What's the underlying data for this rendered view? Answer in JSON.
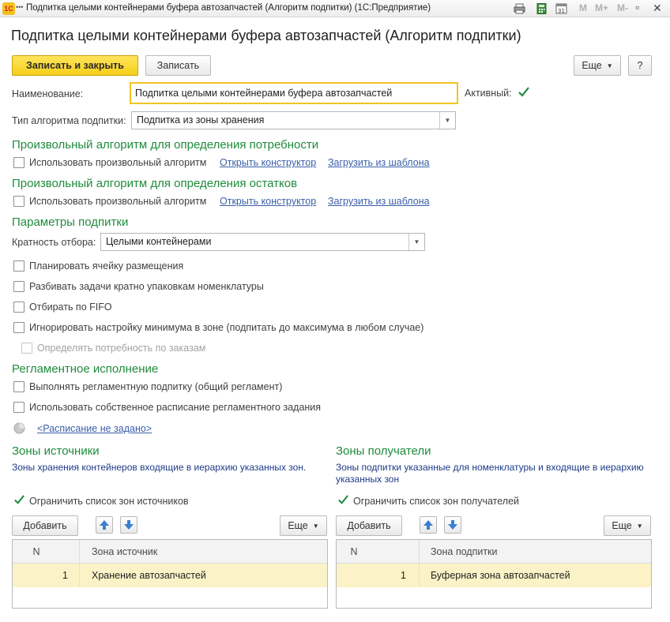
{
  "window": {
    "title": "Подпитка целыми контейнерами буфера автозапчастей (Алгоритм подпитки)  (1С:Предприятие)",
    "app_icon_text": "1С",
    "toolbar_icons": [
      "print-icon",
      "calculator-icon",
      "calendar-icon"
    ],
    "memory_buttons": [
      "M",
      "M+",
      "M-"
    ],
    "controls": [
      "restore-icon",
      "close-icon"
    ]
  },
  "page": {
    "title": "Подпитка целыми контейнерами буфера автозапчастей (Алгоритм подпитки)"
  },
  "command_bar": {
    "save_close": "Записать и закрыть",
    "save": "Записать",
    "more": "Еще",
    "help": "?"
  },
  "form": {
    "name_label": "Наименование:",
    "name_value": "Подпитка целыми контейнерами буфера автозапчастей",
    "active_label": "Активный:",
    "active_checked": true,
    "algo_type_label": "Тип алгоритма подпитки:",
    "algo_type_value": "Подпитка из зоны хранения"
  },
  "demand_section": {
    "title": "Произвольный алгоритм для определения потребности",
    "checkbox_label": "Использовать произвольный алгоритм",
    "link_constructor": "Открыть конструктор",
    "link_template": "Загрузить из шаблона"
  },
  "stock_section": {
    "title": "Произвольный алгоритм для определения остатков",
    "checkbox_label": "Использовать произвольный алгоритм",
    "link_constructor": "Открыть конструктор",
    "link_template": "Загрузить из шаблона"
  },
  "params_section": {
    "title": "Параметры подпитки",
    "multiplicity_label": "Кратность отбора:",
    "multiplicity_value": "Целыми контейнерами",
    "options": [
      {
        "label": "Планировать ячейку размещения",
        "checked": false,
        "disabled": false
      },
      {
        "label": "Разбивать задачи кратно упаковкам номенклатуры",
        "checked": false,
        "disabled": false
      },
      {
        "label": "Отбирать по FIFO",
        "checked": false,
        "disabled": false
      },
      {
        "label": "Игнорировать настройку минимума в зоне (подпитать до максимума в любом случае)",
        "checked": false,
        "disabled": false
      },
      {
        "label": "Определять потребность по заказам",
        "checked": false,
        "disabled": true
      }
    ]
  },
  "schedule_section": {
    "title": "Регламентное исполнение",
    "option_regular": "Выполнять регламентную подпитку (общий регламент)",
    "option_own_schedule": "Использовать собственное расписание регламентного задания",
    "schedule_link": "<Расписание не задано>"
  },
  "sources": {
    "title": "Зоны источники",
    "note": "Зоны хранения контейнеров входящие в иерархию указанных зон.",
    "limit_label": "Ограничить список зон источников",
    "limit_checked": true,
    "add_button": "Добавить",
    "more_button": "Еще",
    "columns": [
      "N",
      "Зона источник"
    ],
    "rows": [
      {
        "n": "1",
        "zone": "Хранение автозапчастей"
      }
    ]
  },
  "receivers": {
    "title": "Зоны получатели",
    "note": "Зоны подпитки указанные для номенклатуры и входящие в иерархию указанных зон",
    "limit_label": "Ограничить список зон получателей",
    "limit_checked": true,
    "add_button": "Добавить",
    "more_button": "Еще",
    "columns": [
      "N",
      "Зона подпитки"
    ],
    "rows": [
      {
        "n": "1",
        "zone": "Буферная зона автозапчастей"
      }
    ]
  },
  "colors": {
    "section_green": "#1f8b3c",
    "primary_yellow": "#f6cf18",
    "link_blue": "#3a5fa8",
    "selected_row": "#fbf3c7"
  }
}
